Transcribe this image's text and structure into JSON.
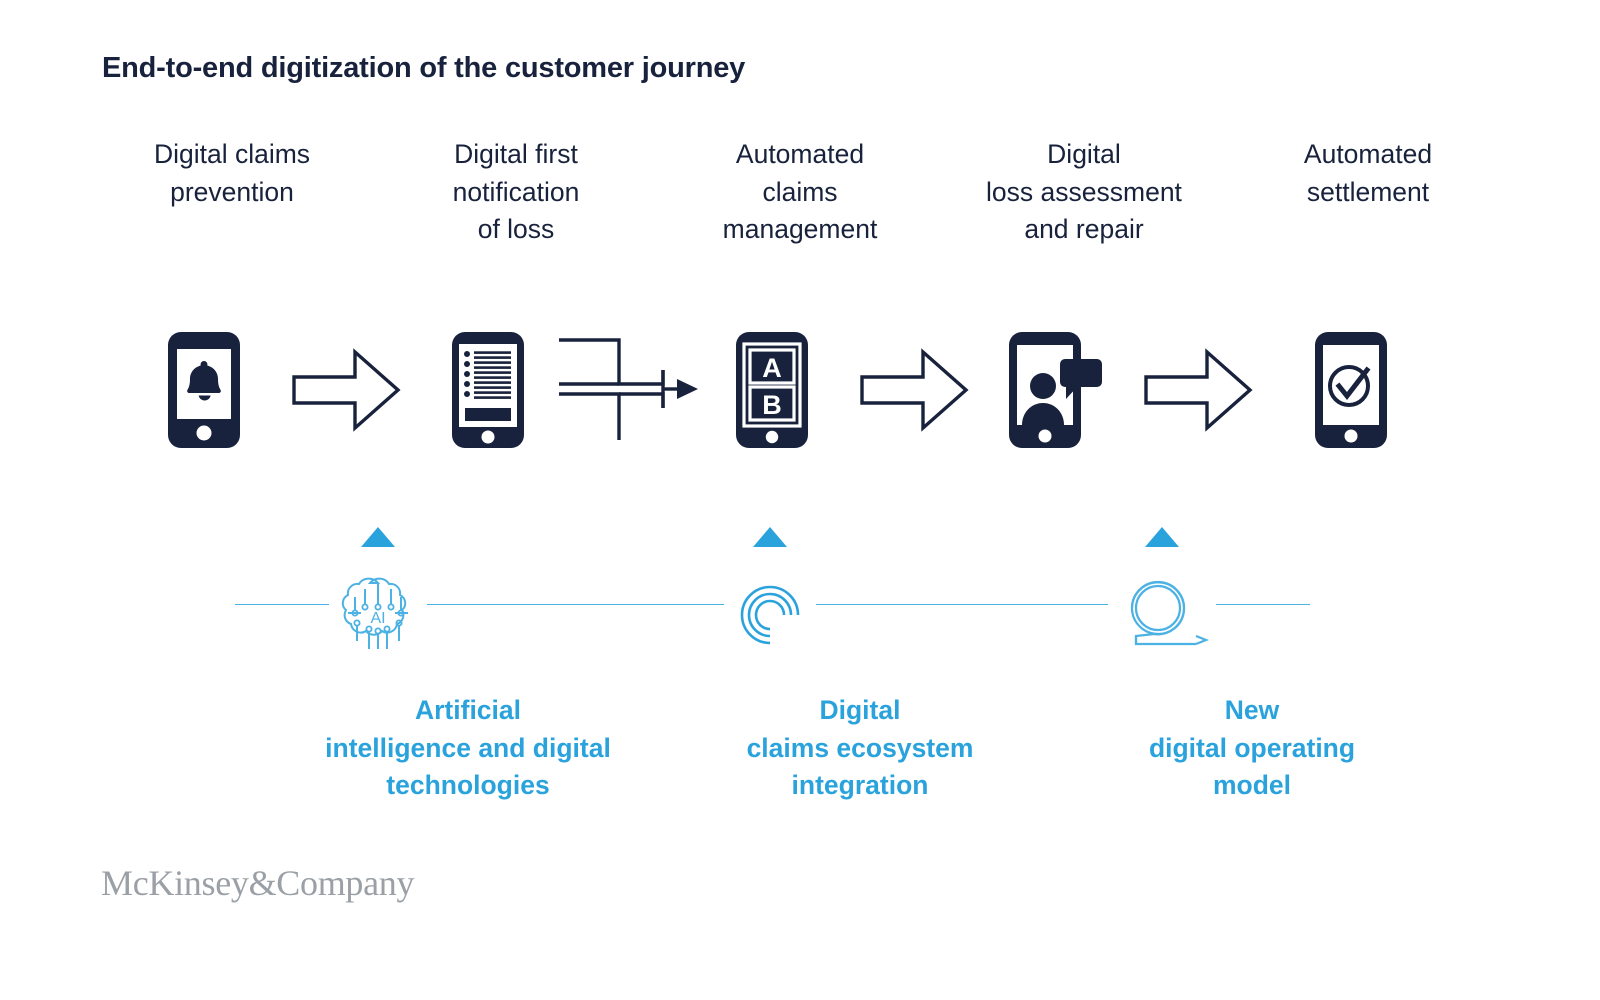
{
  "title": "End-to-end digitization of the customer journey",
  "colors": {
    "navy": "#18223c",
    "accent_blue": "#2aa3dd",
    "rail_blue": "#4cb1e3",
    "logo_gray": "#9aa0a6",
    "background": "#ffffff"
  },
  "stages": [
    {
      "label": "Digital claims\nprevention",
      "icon": "phone-bell-icon"
    },
    {
      "label": "Digital first\nnotification\nof loss",
      "icon": "phone-form-icon"
    },
    {
      "label": "Automated\nclaims\nmanagement",
      "icon": "phone-ab-icon"
    },
    {
      "label": "Digital\nloss assessment\nand repair",
      "icon": "phone-video-call-icon"
    },
    {
      "label": "Automated\nsettlement",
      "icon": "phone-check-icon"
    }
  ],
  "connectors": [
    {
      "type": "block-arrow-right-icon"
    },
    {
      "type": "merge-converge-icon"
    },
    {
      "type": "block-arrow-right-icon"
    },
    {
      "type": "block-arrow-right-icon"
    }
  ],
  "enablers": [
    {
      "caption": "Artificial\nintelligence and digital\ntechnologies",
      "icon": "ai-brain-icon",
      "icon_label": "AI",
      "marker": "triangle-up-marker"
    },
    {
      "caption": "Digital\nclaims ecosystem\nintegration",
      "icon": "concentric-arcs-icon",
      "icon_label": "",
      "marker": "triangle-up-marker"
    },
    {
      "caption": "New\ndigital operating\nmodel",
      "icon": "loop-arrow-icon",
      "icon_label": "",
      "marker": "triangle-up-marker"
    }
  ],
  "logo": "McKinsey&Company"
}
